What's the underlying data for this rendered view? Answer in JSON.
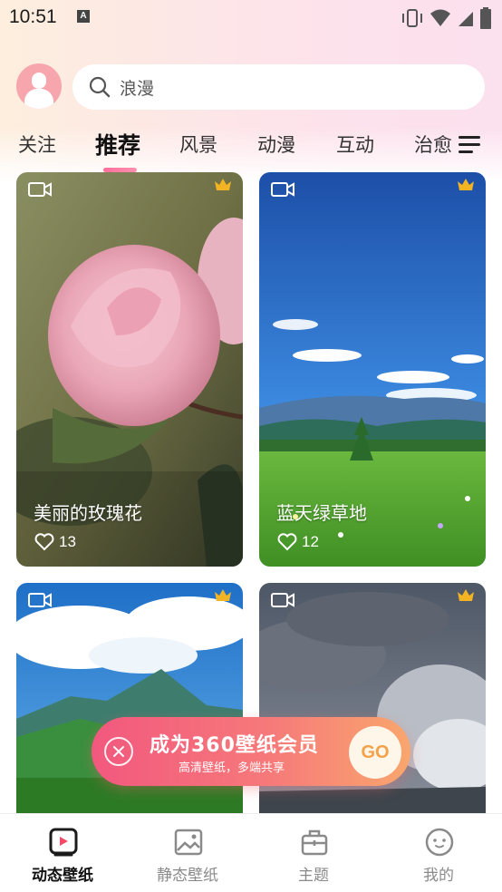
{
  "status_bar": {
    "time": "10:51",
    "notification_icon_label": "A"
  },
  "search": {
    "placeholder": "浪漫"
  },
  "tabs": [
    {
      "label": "关注"
    },
    {
      "label": "推荐",
      "active": true
    },
    {
      "label": "风景"
    },
    {
      "label": "动漫"
    },
    {
      "label": "互动"
    },
    {
      "label": "治愈"
    }
  ],
  "cards": [
    {
      "title": "美丽的玫瑰花",
      "likes": "13"
    },
    {
      "title": "蓝天绿草地",
      "likes": "12"
    },
    {
      "title": "",
      "likes": ""
    },
    {
      "title": "",
      "likes": ""
    }
  ],
  "promo": {
    "title": "成为360壁纸会员",
    "subtitle": "高清壁纸，多端共享",
    "go_label": "GO"
  },
  "bottom_nav": [
    {
      "label": "动态壁纸",
      "icon": "video-wallpaper-icon",
      "active": true
    },
    {
      "label": "静态壁纸",
      "icon": "image-icon"
    },
    {
      "label": "主题",
      "icon": "theme-bag-icon"
    },
    {
      "label": "我的",
      "icon": "face-icon"
    }
  ],
  "colors": {
    "accent": "#ff6f9b",
    "promo_start": "#f2587e",
    "promo_end": "#f9a66d",
    "crown": "#f2b423"
  }
}
